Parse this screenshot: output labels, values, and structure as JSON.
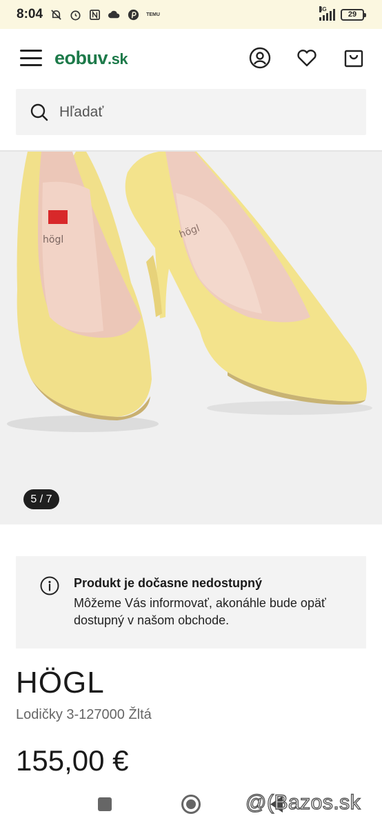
{
  "status_bar": {
    "time": "8:04",
    "network": "4G",
    "battery": "29",
    "temu_label": "TEMU"
  },
  "header": {
    "logo_main": "eobuv",
    "logo_tld": ".sk"
  },
  "search": {
    "placeholder": "Hľadať"
  },
  "gallery": {
    "counter": "5 / 7",
    "insole_brand": "högl"
  },
  "notice": {
    "title": "Produkt je dočasne nedostupný",
    "body": "Môžeme Vás informovať, akonáhle bude opäť dostupný v našom obchode."
  },
  "product": {
    "brand": "HÖGL",
    "name": "Lodičky 3-127000 Žltá",
    "price": "155,00 €"
  },
  "watermark": "@(Bazos.sk",
  "colors": {
    "logo_green": "#1d7a4a",
    "shoe_yellow": "#f3e38c",
    "status_bar_bg": "#fbf7e0"
  }
}
